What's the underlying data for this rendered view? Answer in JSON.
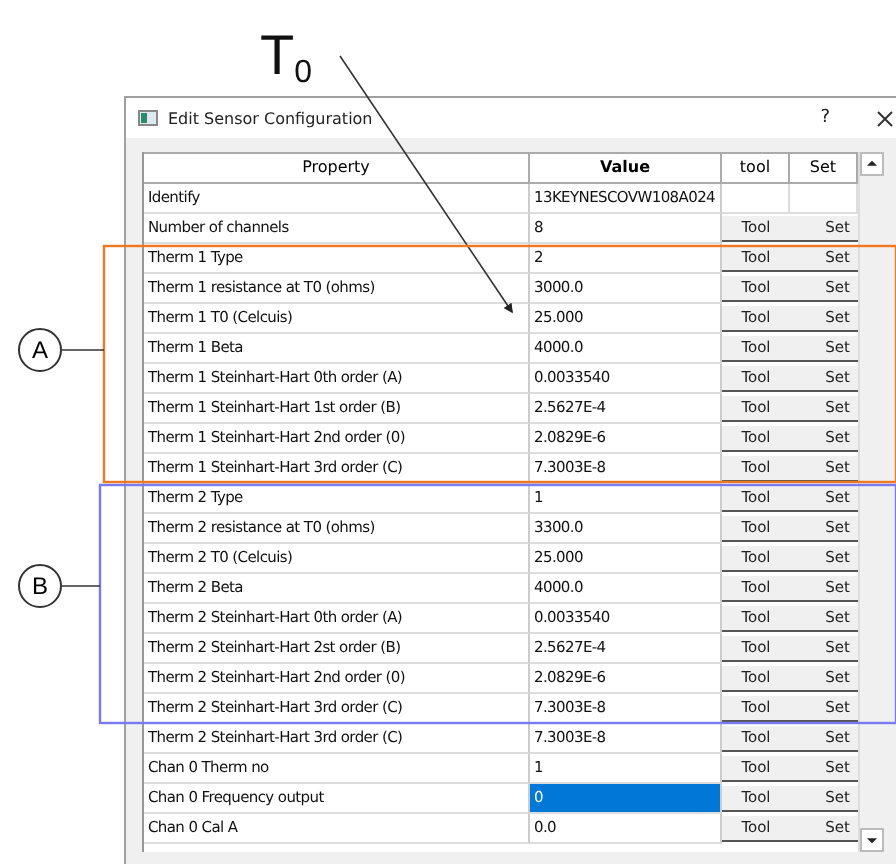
{
  "annotation_label": "T$_{0}$",
  "callouts": [
    {
      "label": "A",
      "color": "#f07820"
    },
    {
      "label": "B",
      "color": "#7a7af0"
    }
  ],
  "window": {
    "title": "Edit Sensor Configuration",
    "help": "?"
  },
  "table": {
    "columns": [
      "Property",
      "Value",
      "tool",
      "Set"
    ],
    "rows": [
      {
        "kind": "info",
        "property": "Identify",
        "value": "13KEYNESCOVW108A024",
        "selected": false
      },
      {
        "kind": "setting",
        "property": "Number of channels",
        "value": "8",
        "tool": "Tool",
        "set": "Set",
        "selected": false
      },
      {
        "kind": "setting",
        "property": "Therm 1 Type",
        "value": "2",
        "tool": "Tool",
        "set": "Set",
        "selected": false
      },
      {
        "kind": "setting",
        "property": "Therm 1 resistance at T0 (ohms)",
        "value": "3000.0",
        "tool": "Tool",
        "set": "Set",
        "selected": false
      },
      {
        "kind": "setting",
        "property": "Therm 1 T0 (Celcuis)",
        "value": "25.000",
        "tool": "Tool",
        "set": "Set",
        "selected": false
      },
      {
        "kind": "setting",
        "property": "Therm 1 Beta",
        "value": "4000.0",
        "tool": "Tool",
        "set": "Set",
        "selected": false
      },
      {
        "kind": "setting",
        "property": "Therm 1 Steinhart-Hart 0th order (A)",
        "value": "0.0033540",
        "tool": "Tool",
        "set": "Set",
        "selected": false
      },
      {
        "kind": "setting",
        "property": "Therm 1 Steinhart-Hart 1st order (B)",
        "value": "2.5627E-4",
        "tool": "Tool",
        "set": "Set",
        "selected": false
      },
      {
        "kind": "setting",
        "property": "Therm 1 Steinhart-Hart 2nd order (0)",
        "value": "2.0829E-6",
        "tool": "Tool",
        "set": "Set",
        "selected": false
      },
      {
        "kind": "setting",
        "property": "Therm 1 Steinhart-Hart 3rd order (C)",
        "value": "7.3003E-8",
        "tool": "Tool",
        "set": "Set",
        "selected": false
      },
      {
        "kind": "setting",
        "property": "Therm 2 Type",
        "value": "1",
        "tool": "Tool",
        "set": "Set",
        "selected": false
      },
      {
        "kind": "setting",
        "property": "Therm 2 resistance at T0 (ohms)",
        "value": "3300.0",
        "tool": "Tool",
        "set": "Set",
        "selected": false
      },
      {
        "kind": "setting",
        "property": "Therm 2 T0 (Celcuis)",
        "value": "25.000",
        "tool": "Tool",
        "set": "Set",
        "selected": false
      },
      {
        "kind": "setting",
        "property": "Therm 2 Beta",
        "value": "4000.0",
        "tool": "Tool",
        "set": "Set",
        "selected": false
      },
      {
        "kind": "setting",
        "property": "Therm 2 Steinhart-Hart 0th order (A)",
        "value": "0.0033540",
        "tool": "Tool",
        "set": "Set",
        "selected": false
      },
      {
        "kind": "setting",
        "property": "Therm 2 Steinhart-Hart 2st order (B)",
        "value": "2.5627E-4",
        "tool": "Tool",
        "set": "Set",
        "selected": false
      },
      {
        "kind": "setting",
        "property": "Therm 2 Steinhart-Hart 2nd order (0)",
        "value": "2.0829E-6",
        "tool": "Tool",
        "set": "Set",
        "selected": false
      },
      {
        "kind": "setting",
        "property": "Therm 2 Steinhart-Hart 3rd order (C)",
        "value": "7.3003E-8",
        "tool": "Tool",
        "set": "Set",
        "selected": false
      },
      {
        "kind": "setting",
        "property": "Therm 2 Steinhart-Hart 3rd order (C)",
        "value": "7.3003E-8",
        "tool": "Tool",
        "set": "Set",
        "selected": false
      },
      {
        "kind": "setting",
        "property": "Chan 0 Therm no",
        "value": "1",
        "tool": "Tool",
        "set": "Set",
        "selected": false
      },
      {
        "kind": "setting",
        "property": "Chan 0 Frequency output",
        "value": "0",
        "tool": "Tool",
        "set": "Set",
        "selected": true
      },
      {
        "kind": "setting",
        "property": "Chan 0 Cal A",
        "value": "0.0",
        "tool": "Tool",
        "set": "Set",
        "selected": false
      }
    ]
  }
}
